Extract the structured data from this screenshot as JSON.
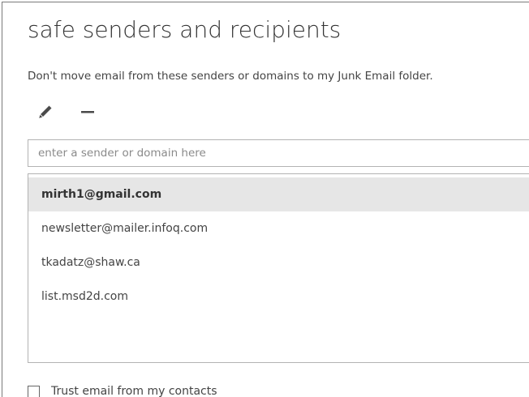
{
  "page": {
    "title": "safe senders and recipients",
    "description": "Don't move email from these senders or domains to my Junk Email folder."
  },
  "toolbar": {
    "edit_icon": "pencil-icon",
    "remove_icon": "minus-icon"
  },
  "sender_input": {
    "placeholder": "enter a sender or domain here",
    "value": ""
  },
  "safe_senders_list": {
    "items": [
      {
        "label": "mirth1@gmail.com",
        "selected": true
      },
      {
        "label": "newsletter@mailer.infoq.com",
        "selected": false
      },
      {
        "label": "tkadatz@shaw.ca",
        "selected": false
      },
      {
        "label": "list.msd2d.com",
        "selected": false
      }
    ]
  },
  "trust_contacts": {
    "label": "Trust email from my contacts",
    "checked": false
  },
  "colors": {
    "selected_row_bg": "#e6e6e6",
    "icon_color": "#4a4a4a",
    "border_color": "#b3b3b3"
  }
}
